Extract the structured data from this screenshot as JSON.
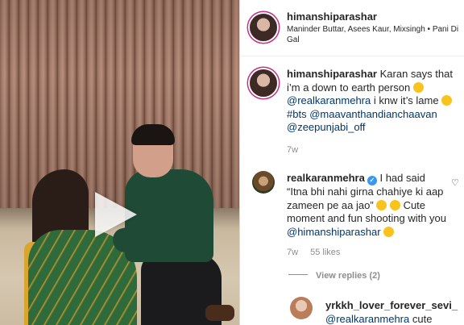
{
  "post": {
    "author": "himanshiparashar",
    "audio": "Maninder Buttar, Asees Kaur, Mixsingh • Pani Di Gal"
  },
  "caption": {
    "username": "himanshiparashar",
    "text_1": "Karan says that i’m a down to earth person",
    "mention": "@realkaranmehra",
    "text_2": "i knw it’s lame",
    "tag_bts": "#bts",
    "mention_2": "@maavanthandianchaavan",
    "mention_3": "@zeepunjabi_off",
    "time": "7w"
  },
  "comments": [
    {
      "username": "realkaranmehra",
      "verified": true,
      "text_1": "I had said “Itna bhi nahi girna chahiye ki aap zameen pe aa jao”",
      "text_2": "Cute moment and fun shooting with you",
      "mention": "@himanshiparashar",
      "time": "7w",
      "likes": "55 likes",
      "view_replies": "View replies (2)"
    },
    {
      "username": "yrkkh_lover_forever_sevi_",
      "mention": "@realkaranmehra",
      "text": "cute"
    }
  ],
  "icons": {
    "play": "play-icon",
    "verified": "verified-badge-icon",
    "like": "heart-outline-icon",
    "emoji": "emoji-icon"
  },
  "colors": {
    "link": "#00376b",
    "meta": "#8e8e8e",
    "verified": "#3897f0",
    "story_ring": "#c13584"
  }
}
